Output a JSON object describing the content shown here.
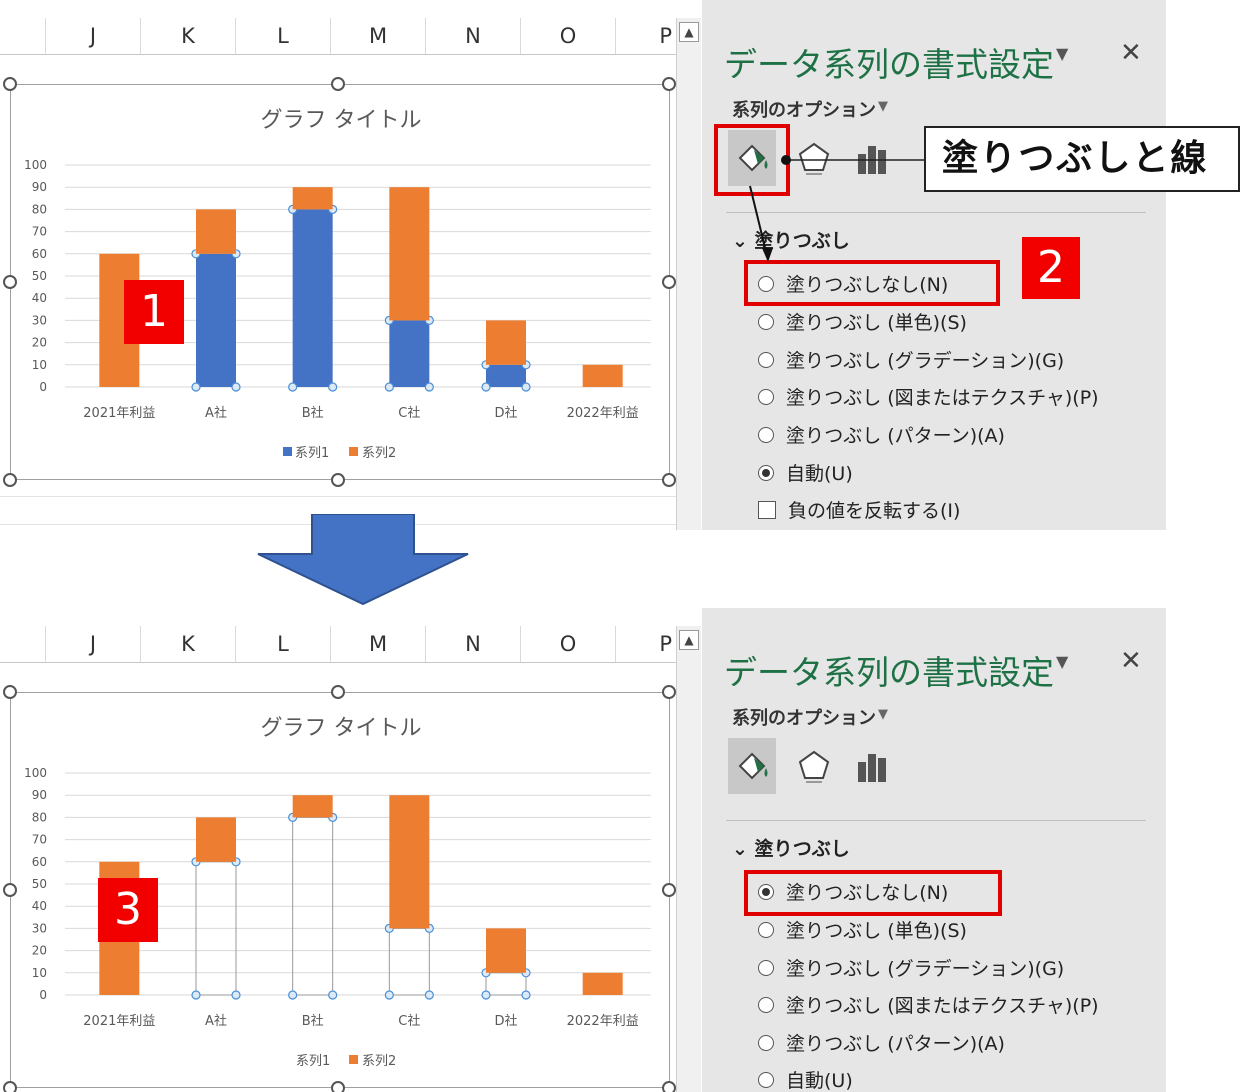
{
  "columns": [
    "J",
    "K",
    "L",
    "M",
    "N",
    "O",
    "P"
  ],
  "chart": {
    "title": "グラフ タイトル",
    "legend": [
      "系列1",
      "系列2"
    ]
  },
  "chart_data": {
    "type": "bar",
    "stacked": true,
    "categories": [
      "2021年利益",
      "A社",
      "B社",
      "C社",
      "D社",
      "2022年利益"
    ],
    "series": [
      {
        "name": "系列1",
        "values": [
          0,
          60,
          80,
          30,
          10,
          0
        ],
        "color": "#4472c4"
      },
      {
        "name": "系列2",
        "values": [
          60,
          20,
          10,
          60,
          20,
          10
        ],
        "color": "#ed7d31"
      }
    ],
    "yticks": [
      0,
      10,
      20,
      30,
      40,
      50,
      60,
      70,
      80,
      90,
      100
    ],
    "ylim": [
      0,
      100
    ],
    "grid": true,
    "legend_position": "bottom"
  },
  "pane": {
    "title": "データ系列の書式設定",
    "subtitle": "系列のオプション",
    "section": "塗りつぶし",
    "options_top": [
      "塗りつぶしなし(N)",
      "塗りつぶし (単色)(S)",
      "塗りつぶし (グラデーション)(G)",
      "塗りつぶし (図またはテクスチャ)(P)",
      "塗りつぶし (パターン)(A)",
      "自動(U)"
    ],
    "checkbox_top": "負の値を反転する(I)",
    "options_bottom": [
      "塗りつぶしなし(N)",
      "塗りつぶし (単色)(S)",
      "塗りつぶし (グラデーション)(G)",
      "塗りつぶし (図またはテクスチャ)(P)",
      "塗りつぶし (パターン)(A)",
      "自動(U)"
    ]
  },
  "annotations": {
    "callout": "塗りつぶしと線",
    "num1": "1",
    "num2": "2",
    "num3": "3"
  },
  "colors": {
    "accent": "#1e7145",
    "series1": "#4472c4",
    "series2": "#ed7d31",
    "highlight": "#e00000"
  }
}
